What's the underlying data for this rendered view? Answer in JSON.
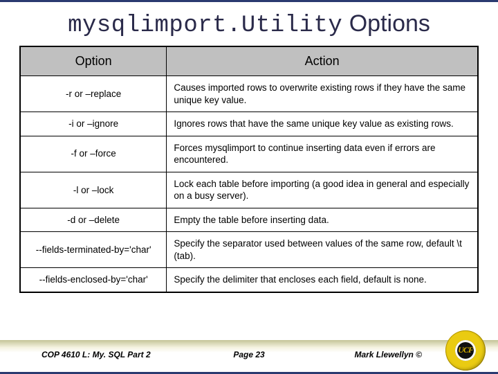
{
  "title": {
    "mono": "mysqlimport.Utility",
    "rest": " Options"
  },
  "table": {
    "headers": {
      "h1": "Option",
      "h2": "Action"
    },
    "rows": [
      {
        "option": "-r or –replace",
        "action": "Causes imported rows to overwrite existing rows if they have the same unique key value."
      },
      {
        "option": "-i or –ignore",
        "action": "Ignores rows that have the same unique key value as existing rows."
      },
      {
        "option": "-f or –force",
        "action": "Forces mysqlimport to continue inserting data even if errors are encountered."
      },
      {
        "option": "-l or –lock",
        "action": "Lock each table before importing (a good idea in general and especially on a busy server)."
      },
      {
        "option": "-d or –delete",
        "action": "Empty the table before inserting data."
      },
      {
        "option": "--fields-terminated-by='char'",
        "action": "Specify the separator used between values of the same row, default \\t (tab)."
      },
      {
        "option": "--fields-enclosed-by='char'",
        "action": "Specify the delimiter that encloses each field, default is none."
      }
    ]
  },
  "footer": {
    "left": "COP 4610 L: My. SQL Part 2",
    "mid": "Page 23",
    "right": "Mark Llewellyn ©"
  }
}
